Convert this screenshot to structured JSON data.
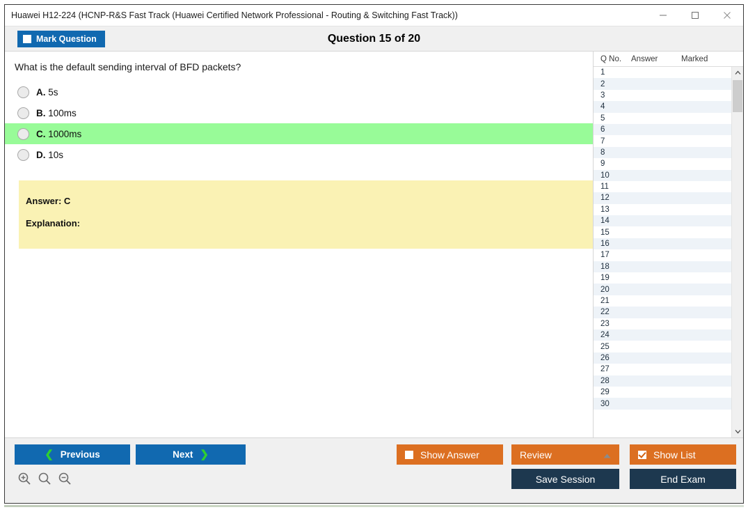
{
  "window": {
    "title": "Huawei H12-224 (HCNP-R&S Fast Track (Huawei Certified Network Professional - Routing & Switching Fast Track))",
    "controls": {
      "minimize": "minimize-icon",
      "maximize": "maximize-icon",
      "close": "close-icon"
    }
  },
  "header": {
    "mark_question_label": "Mark Question",
    "mark_question_checked": false,
    "question_counter": "Question 15 of 20"
  },
  "question": {
    "text": "What is the default sending interval of BFD packets?",
    "options": [
      {
        "letter": "A.",
        "text": "5s",
        "selected": false,
        "highlight": false
      },
      {
        "letter": "B.",
        "text": "100ms",
        "selected": false,
        "highlight": false
      },
      {
        "letter": "C.",
        "text": "1000ms",
        "selected": false,
        "highlight": true
      },
      {
        "letter": "D.",
        "text": "10s",
        "selected": false,
        "highlight": false
      }
    ],
    "answer_label": "Answer: C",
    "explanation_label": "Explanation:"
  },
  "list_panel": {
    "columns": [
      "Q No.",
      "Answer",
      "Marked"
    ],
    "rows": [
      {
        "qno": "1",
        "answer": "",
        "marked": ""
      },
      {
        "qno": "2",
        "answer": "",
        "marked": ""
      },
      {
        "qno": "3",
        "answer": "",
        "marked": ""
      },
      {
        "qno": "4",
        "answer": "",
        "marked": ""
      },
      {
        "qno": "5",
        "answer": "",
        "marked": ""
      },
      {
        "qno": "6",
        "answer": "",
        "marked": ""
      },
      {
        "qno": "7",
        "answer": "",
        "marked": ""
      },
      {
        "qno": "8",
        "answer": "",
        "marked": ""
      },
      {
        "qno": "9",
        "answer": "",
        "marked": ""
      },
      {
        "qno": "10",
        "answer": "",
        "marked": ""
      },
      {
        "qno": "11",
        "answer": "",
        "marked": ""
      },
      {
        "qno": "12",
        "answer": "",
        "marked": ""
      },
      {
        "qno": "13",
        "answer": "",
        "marked": ""
      },
      {
        "qno": "14",
        "answer": "",
        "marked": ""
      },
      {
        "qno": "15",
        "answer": "",
        "marked": ""
      },
      {
        "qno": "16",
        "answer": "",
        "marked": ""
      },
      {
        "qno": "17",
        "answer": "",
        "marked": ""
      },
      {
        "qno": "18",
        "answer": "",
        "marked": ""
      },
      {
        "qno": "19",
        "answer": "",
        "marked": ""
      },
      {
        "qno": "20",
        "answer": "",
        "marked": ""
      },
      {
        "qno": "21",
        "answer": "",
        "marked": ""
      },
      {
        "qno": "22",
        "answer": "",
        "marked": ""
      },
      {
        "qno": "23",
        "answer": "",
        "marked": ""
      },
      {
        "qno": "24",
        "answer": "",
        "marked": ""
      },
      {
        "qno": "25",
        "answer": "",
        "marked": ""
      },
      {
        "qno": "26",
        "answer": "",
        "marked": ""
      },
      {
        "qno": "27",
        "answer": "",
        "marked": ""
      },
      {
        "qno": "28",
        "answer": "",
        "marked": ""
      },
      {
        "qno": "29",
        "answer": "",
        "marked": ""
      },
      {
        "qno": "30",
        "answer": "",
        "marked": ""
      }
    ],
    "scroll_up_icon": "chevron-up-icon",
    "scroll_down_icon": "chevron-down-icon"
  },
  "footer": {
    "previous_label": "Previous",
    "next_label": "Next",
    "show_answer_label": "Show Answer",
    "show_answer_checked": false,
    "review_label": "Review",
    "review_caret_icon": "caret-up-icon",
    "show_list_label": "Show List",
    "show_list_checked": true,
    "save_session_label": "Save Session",
    "end_exam_label": "End Exam",
    "zoom_in_icon": "zoom-in-icon",
    "zoom_reset_icon": "zoom-icon",
    "zoom_out_icon": "zoom-out-icon"
  },
  "colors": {
    "blue_button": "#1169b0",
    "orange_button": "#dc6f21",
    "navy_button": "#1d384f",
    "highlight_green": "#98fb98",
    "answer_yellow": "#faf2b4",
    "row_alt": "#eef3f8"
  }
}
